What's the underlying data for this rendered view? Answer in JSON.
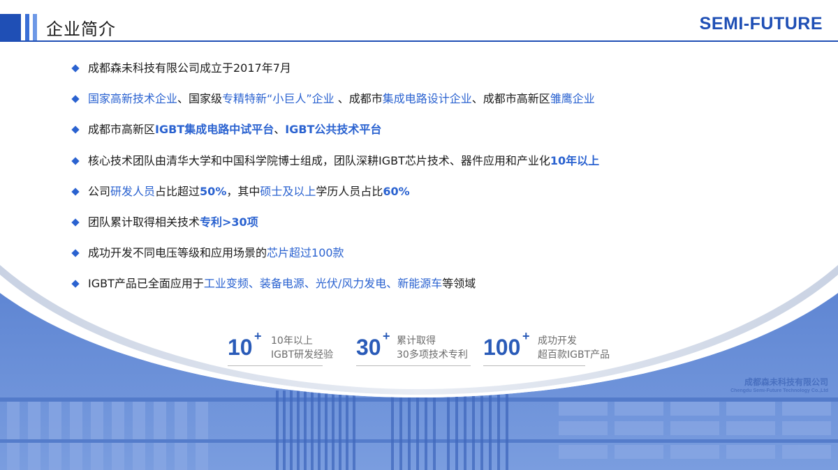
{
  "header": {
    "title": "企业简介",
    "logo": "SEMI-FUTURE",
    "accent_color": "#1f4fb5"
  },
  "bullets": [
    {
      "parts": [
        {
          "t": "成都森未科技有限公司成立于2017年7月",
          "s": ""
        }
      ]
    },
    {
      "parts": [
        {
          "t": "国家高新技术企业",
          "s": "hl"
        },
        {
          "t": "、国家级",
          "s": ""
        },
        {
          "t": "专精特新“小巨人”企业",
          "s": "hl"
        },
        {
          "t": " 、成都市",
          "s": ""
        },
        {
          "t": "集成电路设计企业",
          "s": "hl"
        },
        {
          "t": "、成都市高新区",
          "s": ""
        },
        {
          "t": "雏鹰企业",
          "s": "hl"
        }
      ]
    },
    {
      "parts": [
        {
          "t": "成都市高新区",
          "s": ""
        },
        {
          "t": "IGBT集成电路中试平台",
          "s": "hlb"
        },
        {
          "t": "、",
          "s": ""
        },
        {
          "t": "IGBT公共技术平台",
          "s": "hlb"
        }
      ]
    },
    {
      "parts": [
        {
          "t": "核心技术团队由清华大学和中国科学院博士组成，团队深耕IGBT芯片技术、器件应用和产业化",
          "s": ""
        },
        {
          "t": "10年以上",
          "s": "hlb"
        }
      ]
    },
    {
      "parts": [
        {
          "t": "公司",
          "s": ""
        },
        {
          "t": "研发人员",
          "s": "hl"
        },
        {
          "t": "占比超过",
          "s": ""
        },
        {
          "t": "50%",
          "s": "hlb"
        },
        {
          "t": "，其中",
          "s": ""
        },
        {
          "t": "硕士及以上",
          "s": "hl"
        },
        {
          "t": "学历人员占比",
          "s": ""
        },
        {
          "t": "60%",
          "s": "hlb"
        }
      ]
    },
    {
      "parts": [
        {
          "t": "团队累计取得相关技术",
          "s": ""
        },
        {
          "t": "专利>30项",
          "s": "hlb"
        }
      ]
    },
    {
      "parts": [
        {
          "t": "成功开发不同电压等级和应用场景的",
          "s": ""
        },
        {
          "t": "芯片超过100款",
          "s": "hl"
        }
      ]
    },
    {
      "parts": [
        {
          "t": "IGBT产品已全面应用于",
          "s": ""
        },
        {
          "t": "工业变频、装备电源、光伏/风力发电、新能源车",
          "s": "hl"
        },
        {
          "t": "等领域",
          "s": ""
        }
      ]
    }
  ],
  "stats": [
    {
      "num": "10",
      "plus": "+",
      "line1": "10年以上",
      "line2": "IGBT研发经验"
    },
    {
      "num": "30",
      "plus": "+",
      "line1": "累计取得",
      "line2": "30多项技术专利"
    },
    {
      "num": "100",
      "plus": "+",
      "line1": "成功开发",
      "line2": "超百款IGBT产品"
    }
  ],
  "building": {
    "sign": "成都森未科技有限公司",
    "sign_sub": "Chengdu Semi-Future Technology Co.,Ltd"
  }
}
